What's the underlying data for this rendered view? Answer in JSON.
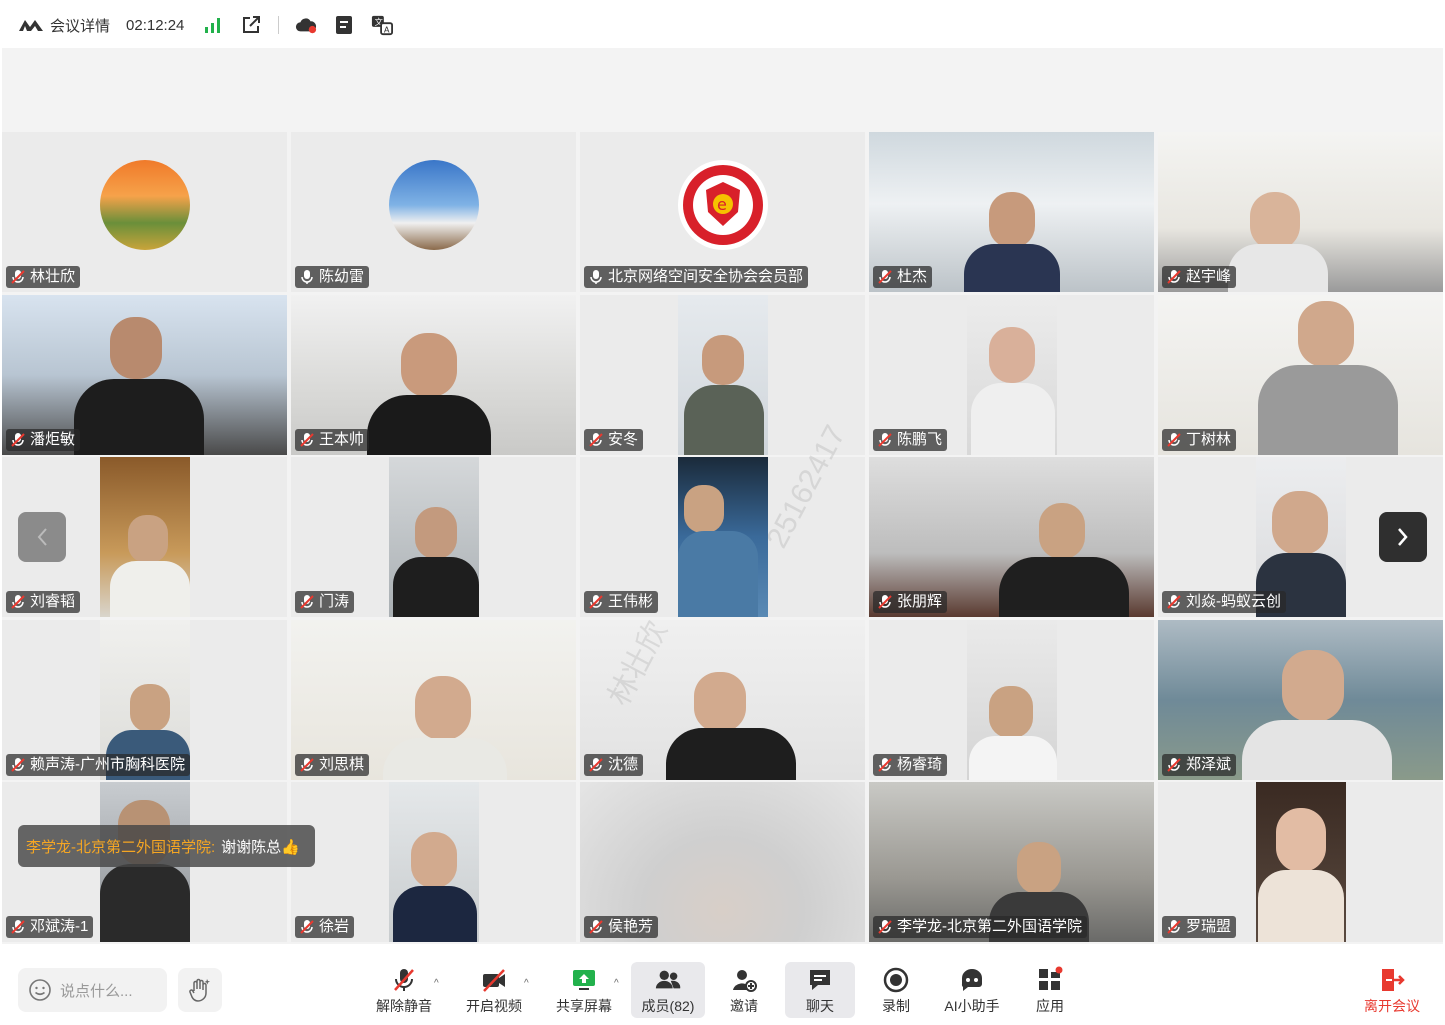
{
  "topbar": {
    "title": "会议详情",
    "timer": "02:12:24",
    "icons": [
      "signal-icon",
      "external-link-icon",
      "cloud-record-icon",
      "notes-icon",
      "translate-icon"
    ]
  },
  "participants": [
    {
      "name": "林壮欣",
      "muted": true
    },
    {
      "name": "陈幼雷",
      "muted": false
    },
    {
      "name": "北京网络空间安全协会会员部",
      "muted": false
    },
    {
      "name": "杜杰",
      "muted": true
    },
    {
      "name": "赵宇峰",
      "muted": true
    },
    {
      "name": "潘炬敏",
      "muted": true
    },
    {
      "name": "王本帅",
      "muted": true
    },
    {
      "name": "安冬",
      "muted": true
    },
    {
      "name": "陈鹏飞",
      "muted": true
    },
    {
      "name": "丁树林",
      "muted": true
    },
    {
      "name": "刘睿韬",
      "muted": true
    },
    {
      "name": "门涛",
      "muted": true
    },
    {
      "name": "王伟彬",
      "muted": true
    },
    {
      "name": "张朋辉",
      "muted": true
    },
    {
      "name": "刘焱-蚂蚁云创",
      "muted": true
    },
    {
      "name": "赖声涛-广州市胸科医院",
      "muted": true
    },
    {
      "name": "刘思棋",
      "muted": true
    },
    {
      "name": "沈德",
      "muted": true
    },
    {
      "name": "杨睿琦",
      "muted": true
    },
    {
      "name": "郑泽斌",
      "muted": true
    },
    {
      "name": "邓斌涛-1",
      "muted": true
    },
    {
      "name": "徐岩",
      "muted": true
    },
    {
      "name": "侯艳芳",
      "muted": true
    },
    {
      "name": "李学龙-北京第二外国语学院",
      "muted": true
    },
    {
      "name": "罗瑞盟",
      "muted": true
    }
  ],
  "chat_popup": {
    "sender": "李学龙-北京第二外国语学院:",
    "message": "谢谢陈总👍"
  },
  "watermark": {
    "name": "林壮欣",
    "number": "25162417"
  },
  "toolbar": {
    "say_placeholder": "说点什么...",
    "unmute": "解除静音",
    "start_video": "开启视频",
    "share_screen": "共享屏幕",
    "members": "成员(82)",
    "invite": "邀请",
    "chat": "聊天",
    "record": "录制",
    "ai_assistant": "AI小助手",
    "apps": "应用",
    "leave": "离开会议"
  },
  "colors": {
    "accent_green": "#22b14c",
    "leave_red": "#e8392f",
    "chat_sender": "#f5a623"
  }
}
